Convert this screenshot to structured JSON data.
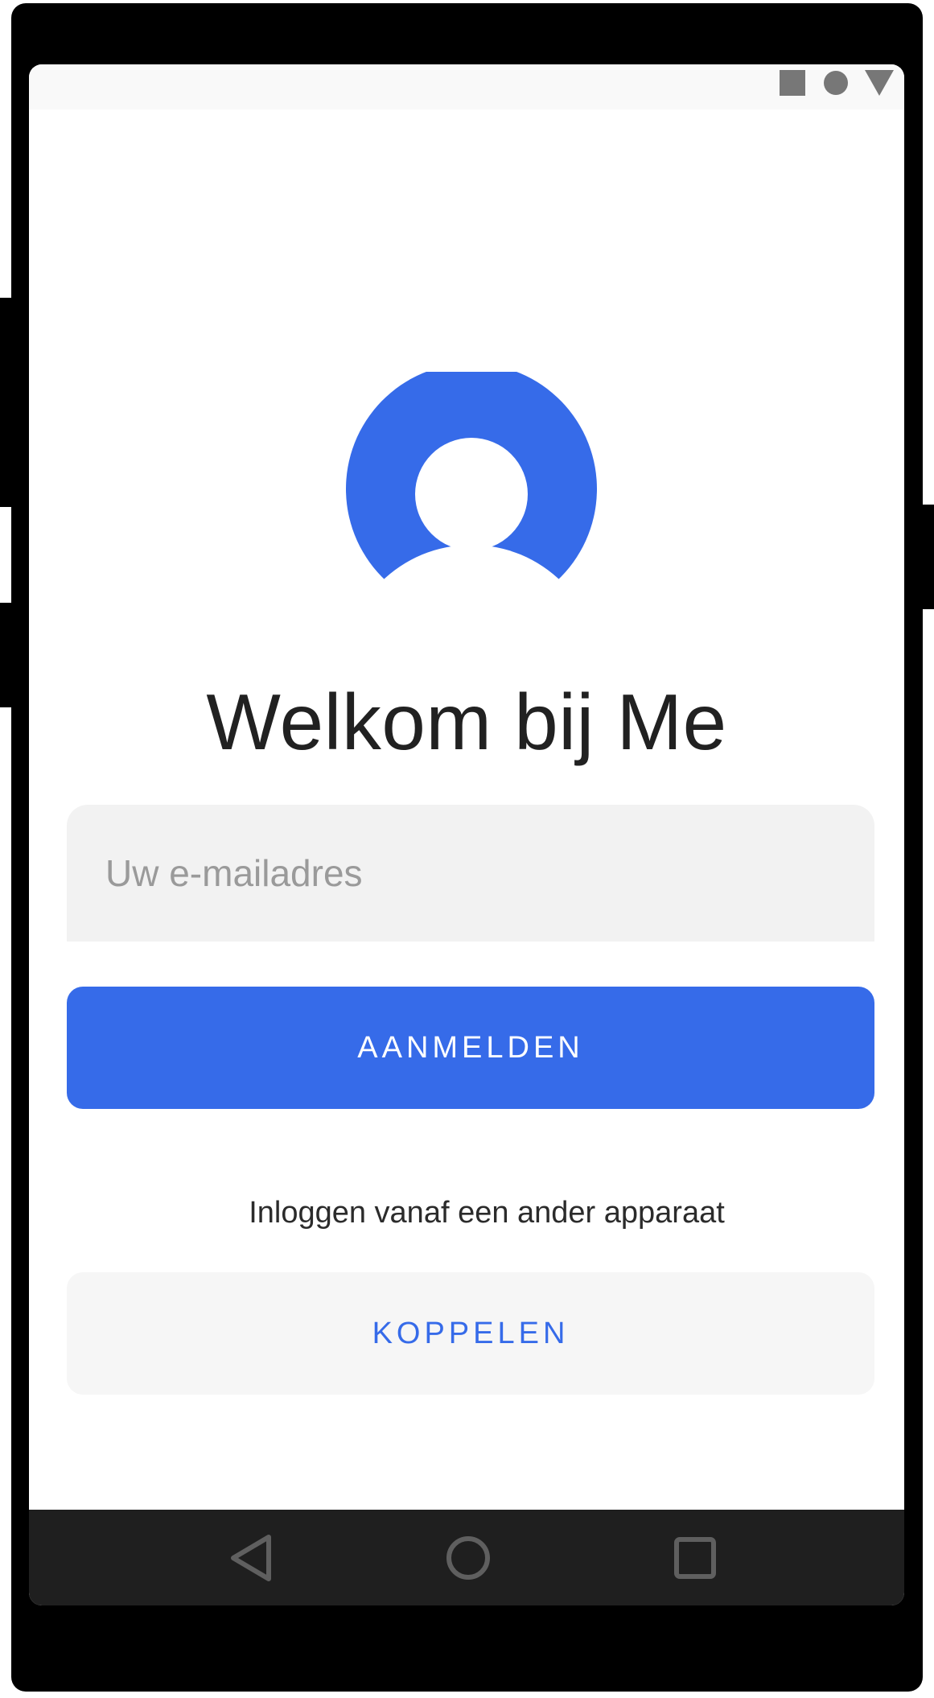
{
  "status_bar": {
    "icons": [
      "square-icon",
      "circle-icon",
      "triangle-down-icon"
    ]
  },
  "welcome": {
    "title": "Welkom bij Me"
  },
  "login": {
    "email_placeholder": "Uw e-mailadres",
    "email_value": "",
    "sign_in_label": "AANMELDEN",
    "other_device_text": "Inloggen vanaf een ander apparaat",
    "link_label": "KOPPELEN"
  },
  "nav_bar": {
    "icons": [
      "back-icon",
      "home-icon",
      "recents-icon"
    ]
  },
  "colors": {
    "accent": "#366be9",
    "input_bg": "#f2f2f2",
    "secondary_btn_bg": "#f6f6f6",
    "nav_bg": "#1f1f1f"
  }
}
